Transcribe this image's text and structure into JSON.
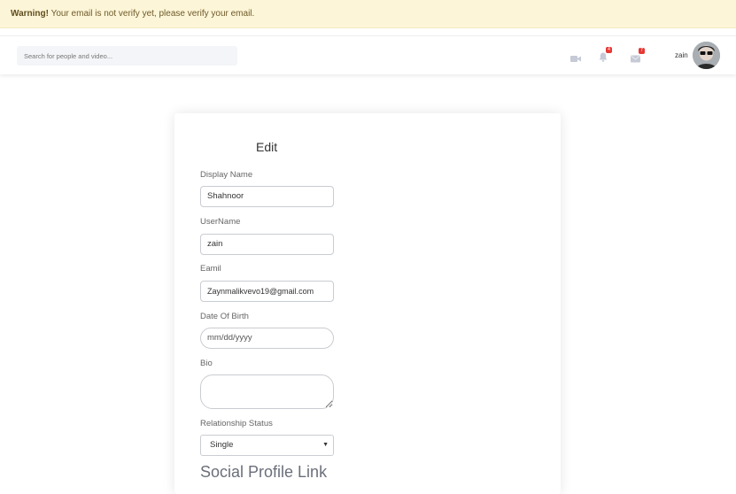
{
  "warning": {
    "strong": "Warning!",
    "text": " Your email is not verify yet, please verify your email."
  },
  "header": {
    "search_placeholder": "Search for people and video...",
    "notifications_count": "4",
    "messages_count": "7",
    "username": "zain"
  },
  "form": {
    "title": "Edit",
    "display_name_label": "Display Name",
    "display_name_value": "Shahnoor",
    "username_label": "UserName",
    "username_value": "zain",
    "email_label": "Eamil",
    "email_value": "Zaynmalikvevo19@gmail.com",
    "dob_label": "Date Of Birth",
    "dob_placeholder": "mm/dd/yyyy",
    "bio_label": "Bio",
    "relationship_label": "Relationship Status",
    "relationship_value": "Single",
    "social_title": "Social Profile Link"
  }
}
